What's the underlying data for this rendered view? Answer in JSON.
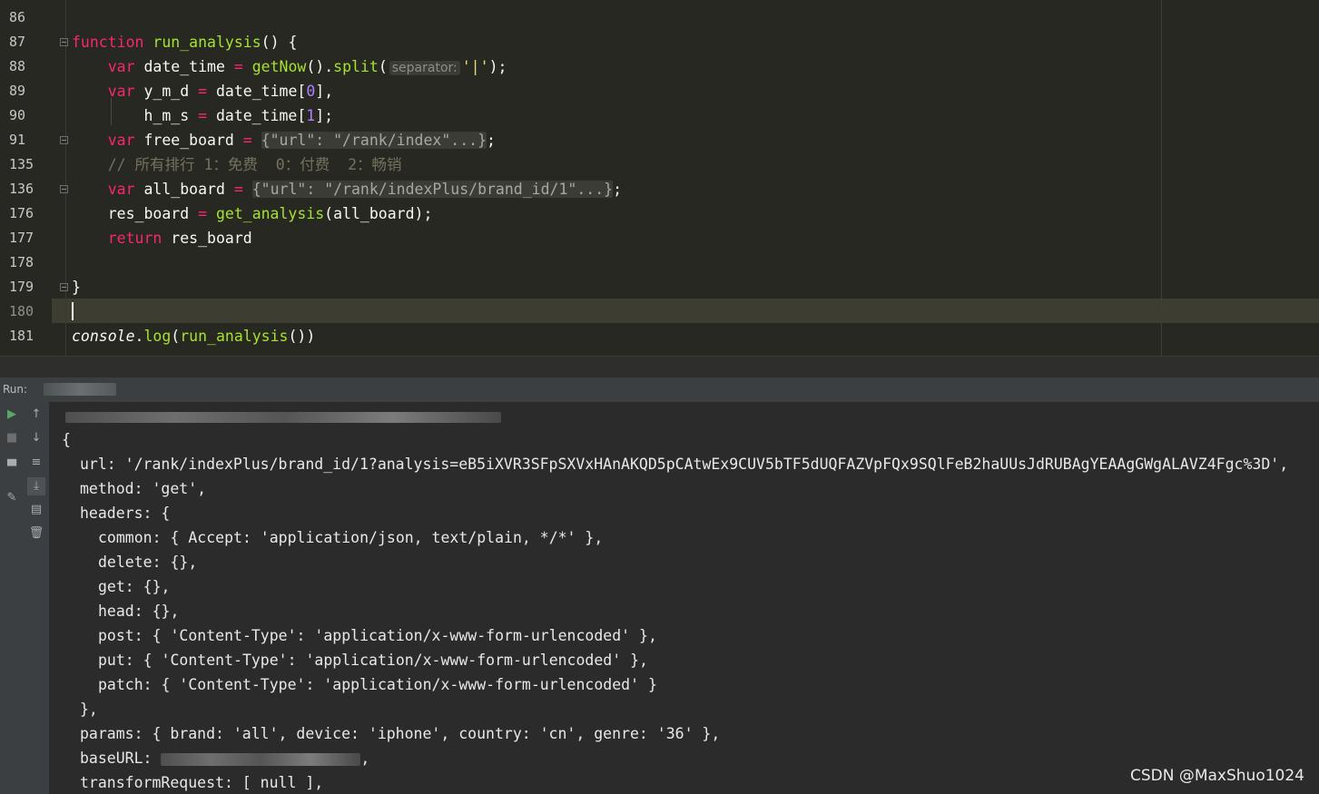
{
  "editor": {
    "line_numbers": [
      "86",
      "87",
      "88",
      "89",
      "90",
      "91",
      "135",
      "136",
      "176",
      "177",
      "178",
      "179",
      "180",
      "181"
    ],
    "hint_separator": "separator:",
    "folded_free_board": "{\"url\": \"/rank/index\"...}",
    "comment_rank": "// 所有排行 1：免费  0：付费  2：畅销",
    "folded_all_board": "{\"url\": \"/rank/indexPlus/brand_id/1\"...}"
  },
  "run_panel": {
    "label": "Run:"
  },
  "console": {
    "line_open": "{",
    "url_key": "url: ",
    "url_value": "'/rank/indexPlus/brand_id/1?analysis=eB5iXVR3SFpSXVxHAnAKQD5pCAtwEx9CUV5bTF5dUQFAZVpFQx9SQlFeB2haUUsJdRUBAgYEAAgGWgALAVZ4Fgc%3D',",
    "method": "method: 'get',",
    "headers_open": "headers: {",
    "common": "common: { Accept: 'application/json, text/plain, */*' },",
    "delete": "delete: {},",
    "get": "get: {},",
    "head": "head: {},",
    "post": "post: { 'Content-Type': 'application/x-www-form-urlencoded' },",
    "put": "put: { 'Content-Type': 'application/x-www-form-urlencoded' },",
    "patch": "patch: { 'Content-Type': 'application/x-www-form-urlencoded' }",
    "headers_close": "},",
    "params": "params: { brand: 'all', device: 'iphone', country: 'cn', genre: '36' },",
    "baseurl_key": "baseURL: ",
    "baseurl_tail": ",",
    "transform": "transformRequest: [ null ],"
  },
  "watermark": "CSDN @MaxShuo1024",
  "colors": {
    "editor_bg": "#272822",
    "keyword": "#f92672",
    "function": "#a6e22e",
    "number": "#ae81ff",
    "string": "#e6db74",
    "comment": "#75715e",
    "console_bg": "#2b2b2b"
  }
}
